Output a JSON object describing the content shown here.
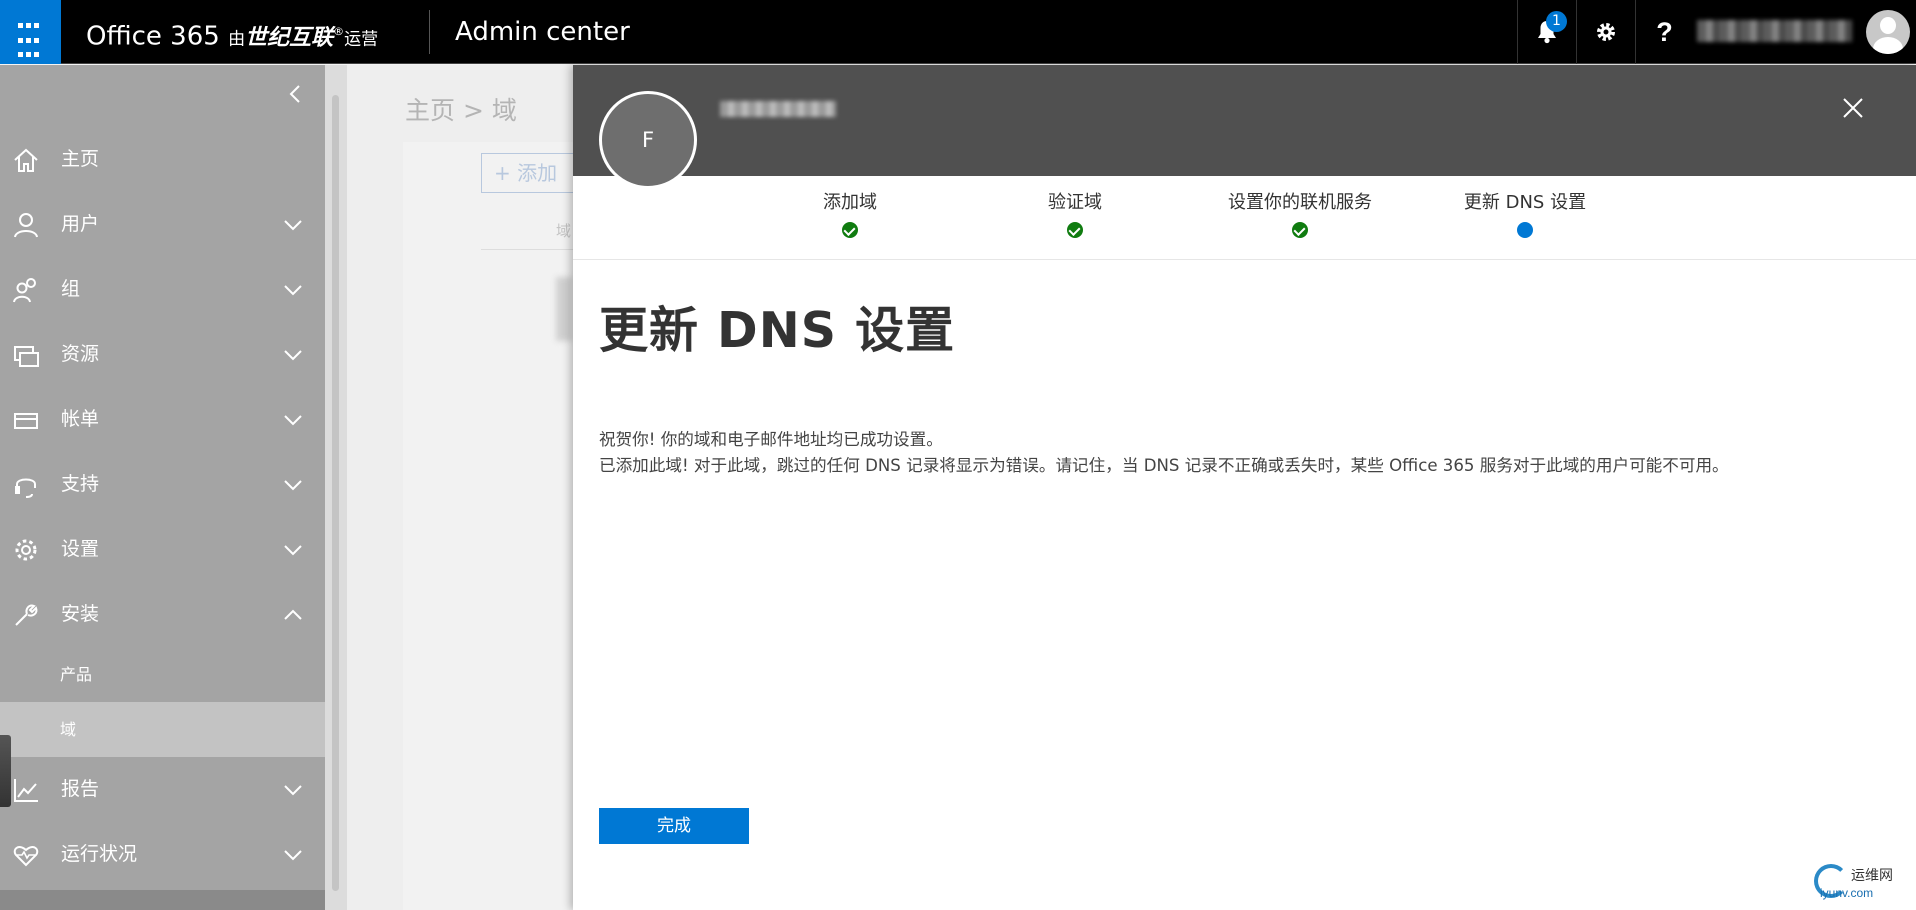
{
  "topbar": {
    "brand_office": "Office 365 ",
    "brand_by": "由",
    "brand_partner": "世纪互联",
    "brand_mark": "®",
    "brand_operate": "运营",
    "app_title": "Admin center",
    "notification_count": "1",
    "help_label": "?"
  },
  "sidebar": {
    "items": [
      {
        "label": "主页",
        "icon": "home-icon"
      },
      {
        "label": "用户",
        "icon": "user-icon"
      },
      {
        "label": "组",
        "icon": "group-icon"
      },
      {
        "label": "资源",
        "icon": "resources-icon"
      },
      {
        "label": "帐单",
        "icon": "billing-icon"
      },
      {
        "label": "支持",
        "icon": "headset-icon"
      },
      {
        "label": "设置",
        "icon": "gear-icon"
      },
      {
        "label": "安装",
        "icon": "wrench-icon"
      },
      {
        "label": "报告",
        "icon": "chart-icon"
      },
      {
        "label": "运行状况",
        "icon": "heart-icon"
      }
    ],
    "subitems": [
      {
        "label": "产品"
      },
      {
        "label": "域",
        "active": true
      }
    ]
  },
  "background_page": {
    "breadcrumb": "主页 > 域",
    "add_label": "添加",
    "column_header": "域"
  },
  "panel": {
    "avatar_letter": "F",
    "steps": [
      {
        "label": "添加域",
        "status": "done"
      },
      {
        "label": "验证域",
        "status": "done"
      },
      {
        "label": "设置你的联机服务",
        "status": "done"
      },
      {
        "label": "更新 DNS 设置",
        "status": "current"
      }
    ],
    "title": "更新 DNS 设置",
    "message_line1": "祝贺你! 你的域和电子邮件地址均已成功设置。",
    "message_line2": "已添加此域! 对于此域，跳过的任何 DNS 记录将显示为错误。请记住，当 DNS 记录不正确或丢失时，某些 Office 365 服务对于此域的用户可能不可用。",
    "finish_button": "完成"
  },
  "watermark": {
    "line1": "运维网",
    "line2": "iyunv.com"
  },
  "colors": {
    "accent": "#0078d4",
    "success": "#107c10",
    "topbar": "#000000",
    "panel_header": "#505050"
  }
}
